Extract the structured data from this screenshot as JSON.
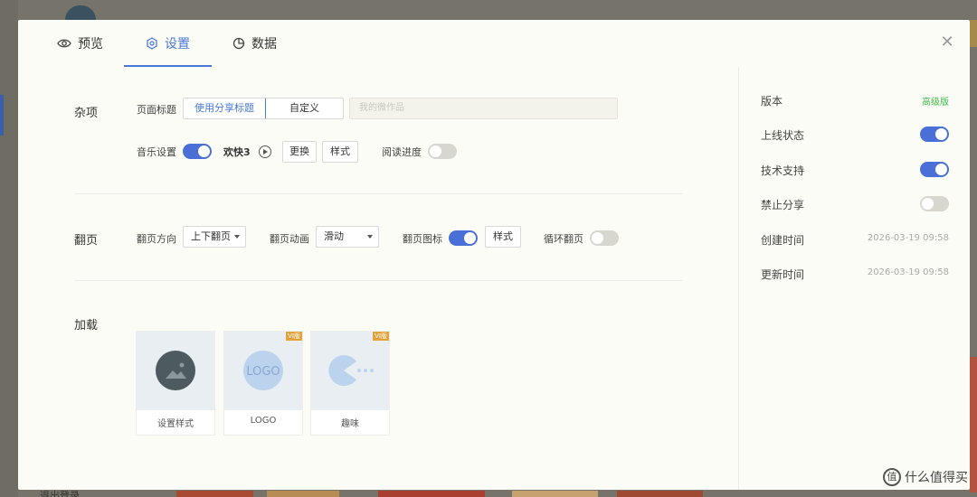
{
  "background": {
    "bottom_text": "退出登录"
  },
  "tabs": [
    {
      "label": "预览",
      "icon": "eye-icon"
    },
    {
      "label": "设置",
      "icon": "gear-icon",
      "active": true
    },
    {
      "label": "数据",
      "icon": "pie-chart-icon"
    }
  ],
  "close_icon": "close-icon",
  "misc": {
    "section_title": "杂项",
    "page_title_label": "页面标题",
    "title_options": [
      "使用分享标题",
      "自定义"
    ],
    "title_selected": "使用分享标题",
    "title_input_placeholder": "我的微作品",
    "music_label": "音乐设置",
    "music_enabled": true,
    "music_name": "欢快3",
    "replace_button": "更换",
    "style_button": "样式",
    "progress_label": "阅读进度",
    "progress_enabled": false
  },
  "paging": {
    "section_title": "翻页",
    "direction_label": "翻页方向",
    "direction_value": "上下翻页",
    "animation_label": "翻页动画",
    "animation_value": "滑动",
    "icon_label": "翻页图标",
    "icon_enabled": true,
    "style_button": "样式",
    "loop_label": "循环翻页",
    "loop_enabled": false
  },
  "loading": {
    "section_title": "加载",
    "cards": [
      {
        "label": "设置样式",
        "badge": ""
      },
      {
        "label": "LOGO",
        "badge": "VI版",
        "logo_text": "LOGO"
      },
      {
        "label": "趣味",
        "badge": "VI版"
      }
    ]
  },
  "side": {
    "version_label": "版本",
    "version_value": "高级版",
    "online_label": "上线状态",
    "online_enabled": true,
    "support_label": "技术支持",
    "support_enabled": true,
    "share_label": "禁止分享",
    "share_enabled": false,
    "created_label": "创建时间",
    "created_value": "2026-03-19 09:58",
    "updated_label": "更新时间",
    "updated_value": "2026-03-19 09:58"
  },
  "watermark": {
    "icon_text": "值",
    "text": "什么值得买"
  },
  "colors": {
    "accent": "#4a78d6",
    "switch_on": "#4a6fd6",
    "premium": "#3fbd49",
    "badge": "#e3a23b"
  }
}
